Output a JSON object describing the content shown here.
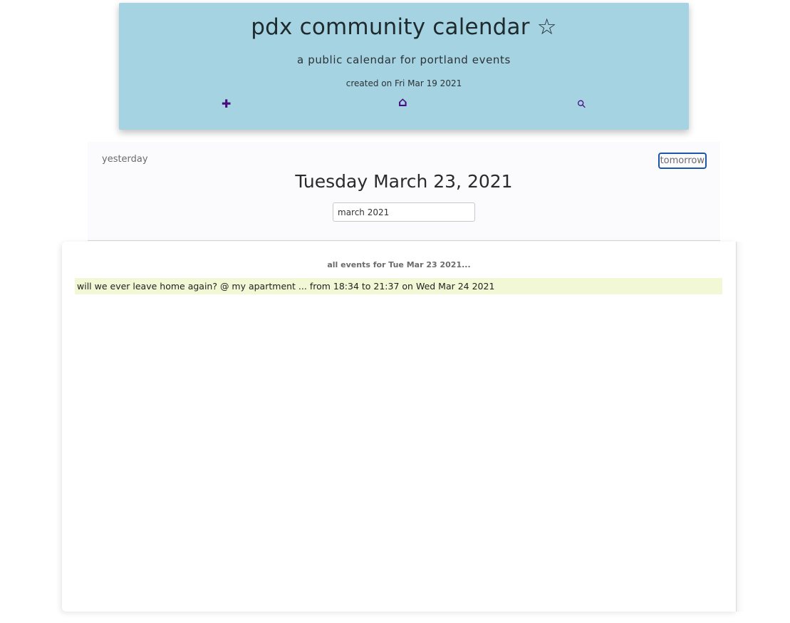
{
  "header": {
    "title": "pdx community calendar ☆",
    "subtitle": "a public calendar for portland events",
    "created": "created on Fri Mar 19 2021",
    "nav": {
      "add_glyph": "✚",
      "add_icon": "plus-icon",
      "home_glyph": "⌂",
      "home_icon": "home-icon",
      "search_glyph": "⚲",
      "search_icon": "magnifier-icon"
    }
  },
  "day_nav": {
    "prev_label": "yesterday",
    "next_label": "tomorrow",
    "date_heading": "Tuesday March 23, 2021",
    "month_value": "march 2021"
  },
  "events": {
    "caption": "all events for Tue Mar 23 2021...",
    "items": [
      "will we ever leave home again? @ my apartment ... from 18:34 to 21:37 on Wed Mar 24 2021"
    ]
  },
  "colors": {
    "header_bg": "#a6d3e2",
    "icon_color": "#4a0a80",
    "event_highlight": "#f2f8d5",
    "focus_outline": "#1f55a8"
  }
}
